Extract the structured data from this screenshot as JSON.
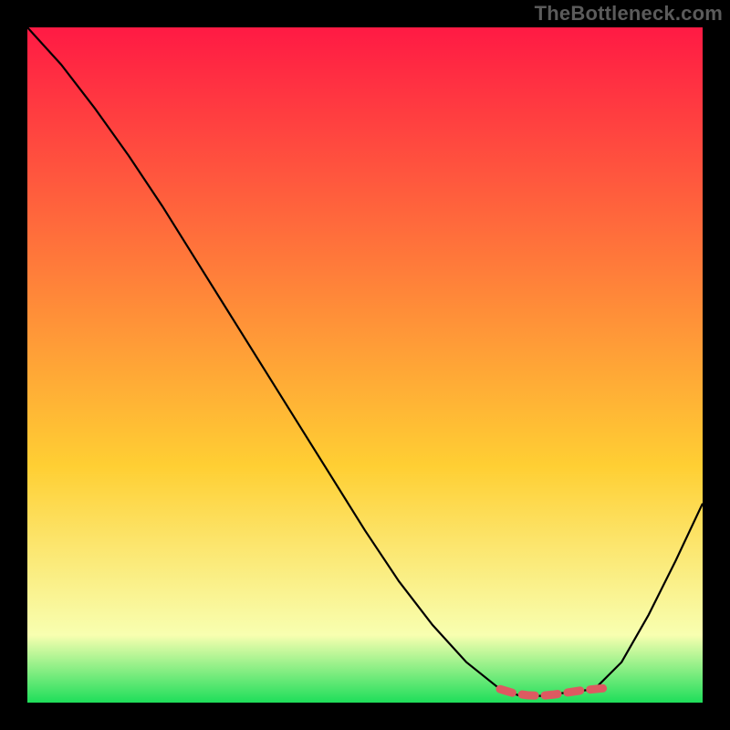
{
  "watermark": "TheBottleneck.com",
  "chart_data": {
    "type": "line",
    "title": "",
    "xlabel": "",
    "ylabel": "",
    "xlim": [
      0,
      1
    ],
    "ylim": [
      0,
      1
    ],
    "grid": false,
    "legend": false,
    "background_gradient": {
      "top": "#ff1a44",
      "middle": "#ffcf33",
      "bottom": "#1ede5a"
    },
    "series": [
      {
        "name": "curve",
        "color": "#000000",
        "x": [
          0.0,
          0.05,
          0.1,
          0.15,
          0.2,
          0.25,
          0.3,
          0.35,
          0.4,
          0.45,
          0.5,
          0.55,
          0.6,
          0.65,
          0.7,
          0.73,
          0.76,
          0.8,
          0.84,
          0.88,
          0.92,
          0.96,
          1.0
        ],
        "y": [
          1.0,
          0.945,
          0.88,
          0.81,
          0.735,
          0.655,
          0.575,
          0.495,
          0.415,
          0.335,
          0.255,
          0.18,
          0.115,
          0.06,
          0.02,
          0.01,
          0.01,
          0.015,
          0.02,
          0.06,
          0.13,
          0.21,
          0.295
        ]
      },
      {
        "name": "bottom-marker",
        "color": "#dd5a61",
        "style": "dashed-thick",
        "x": [
          0.7,
          0.72,
          0.74,
          0.76,
          0.78,
          0.8,
          0.82,
          0.84,
          0.86
        ],
        "y": [
          0.02,
          0.014,
          0.011,
          0.01,
          0.012,
          0.015,
          0.018,
          0.02,
          0.022
        ]
      }
    ]
  }
}
